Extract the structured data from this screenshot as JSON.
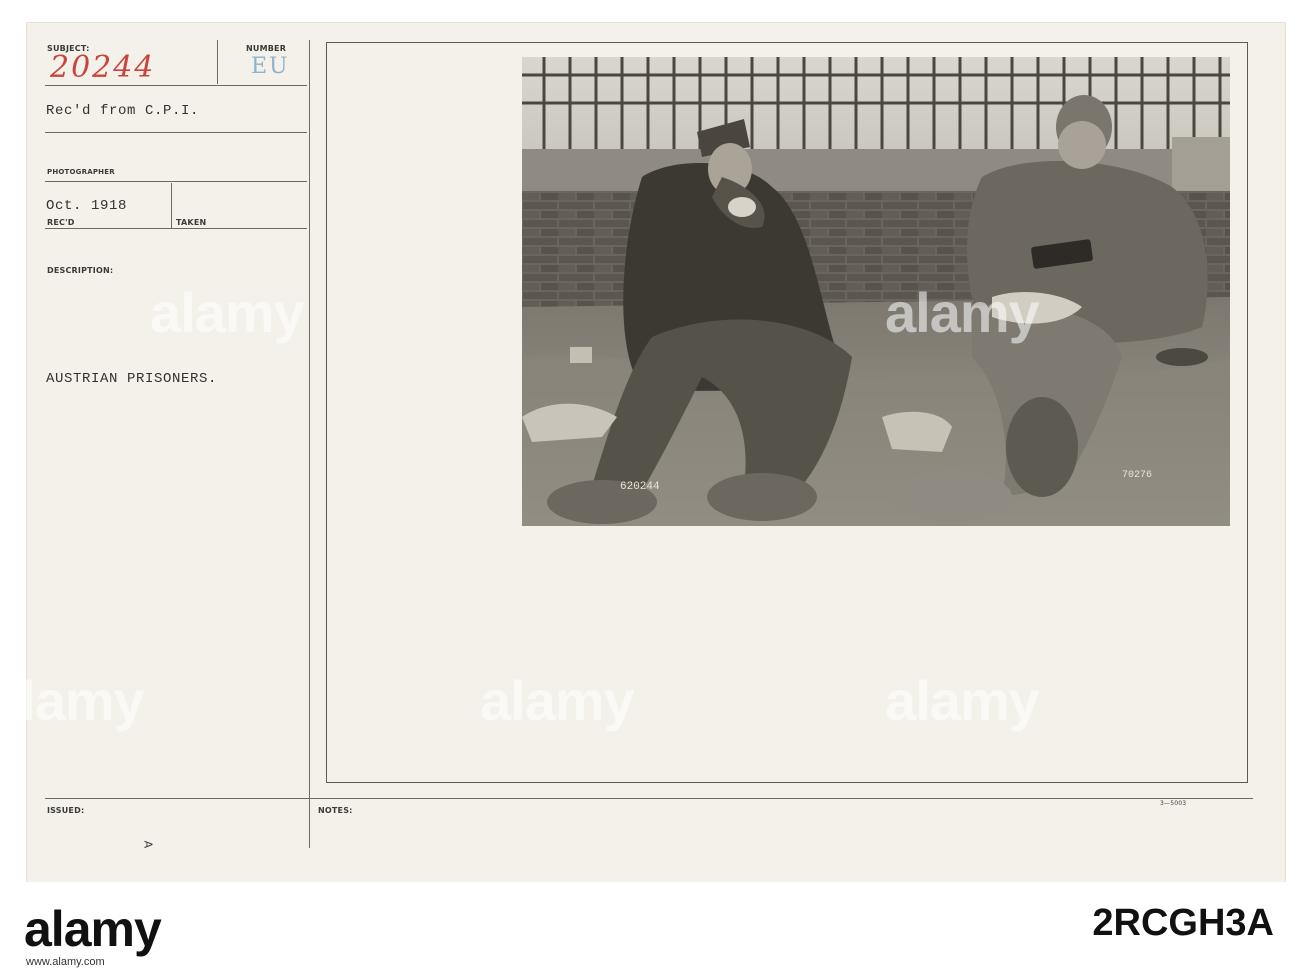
{
  "card": {
    "subject_label": "SUBJECT:",
    "subject_value": "20244",
    "number_label": "NUMBER",
    "number_value": "EU",
    "received_from": "Rec'd from C.P.I.",
    "photographer_label": "PHOTOGRAPHER",
    "date_value": "Oct. 1918",
    "recd_label": "REC'D",
    "taken_label": "TAKEN",
    "description_label": "DESCRIPTION:",
    "description_value": "AUSTRIAN PRISONERS.",
    "issued_label": "ISSUED:",
    "notes_label": "NOTES:",
    "form_number": "3—5003",
    "margin_mark": "A"
  },
  "photo": {
    "negative_number": "620244",
    "corner_mark": "70276"
  },
  "watermark": {
    "text": "alamy"
  },
  "footer": {
    "logo": "alamy",
    "image_id": "2RCGH3A",
    "url": "www.alamy.com"
  }
}
